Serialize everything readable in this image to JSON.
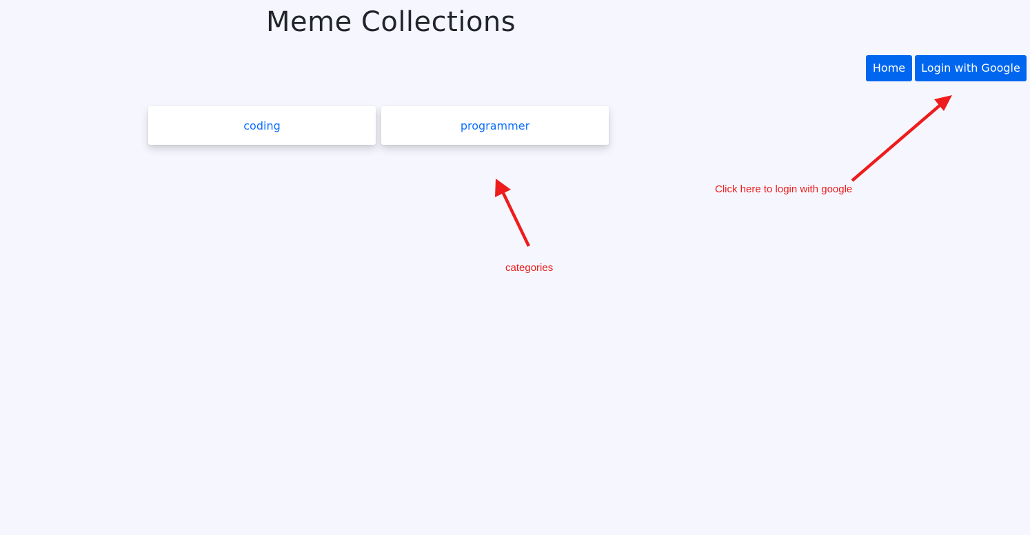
{
  "header": {
    "title": "Meme Collections"
  },
  "nav": {
    "home_label": "Home",
    "login_label": "Login with Google"
  },
  "categories": [
    {
      "label": "coding"
    },
    {
      "label": "programmer"
    }
  ],
  "annotations": {
    "login_note": "Click here to login with google",
    "categories_note": "categories"
  },
  "colors": {
    "background": "#f6f7fe",
    "button": "#0066f0",
    "link": "#0d6efd",
    "annotation": "#ee1c1c"
  }
}
